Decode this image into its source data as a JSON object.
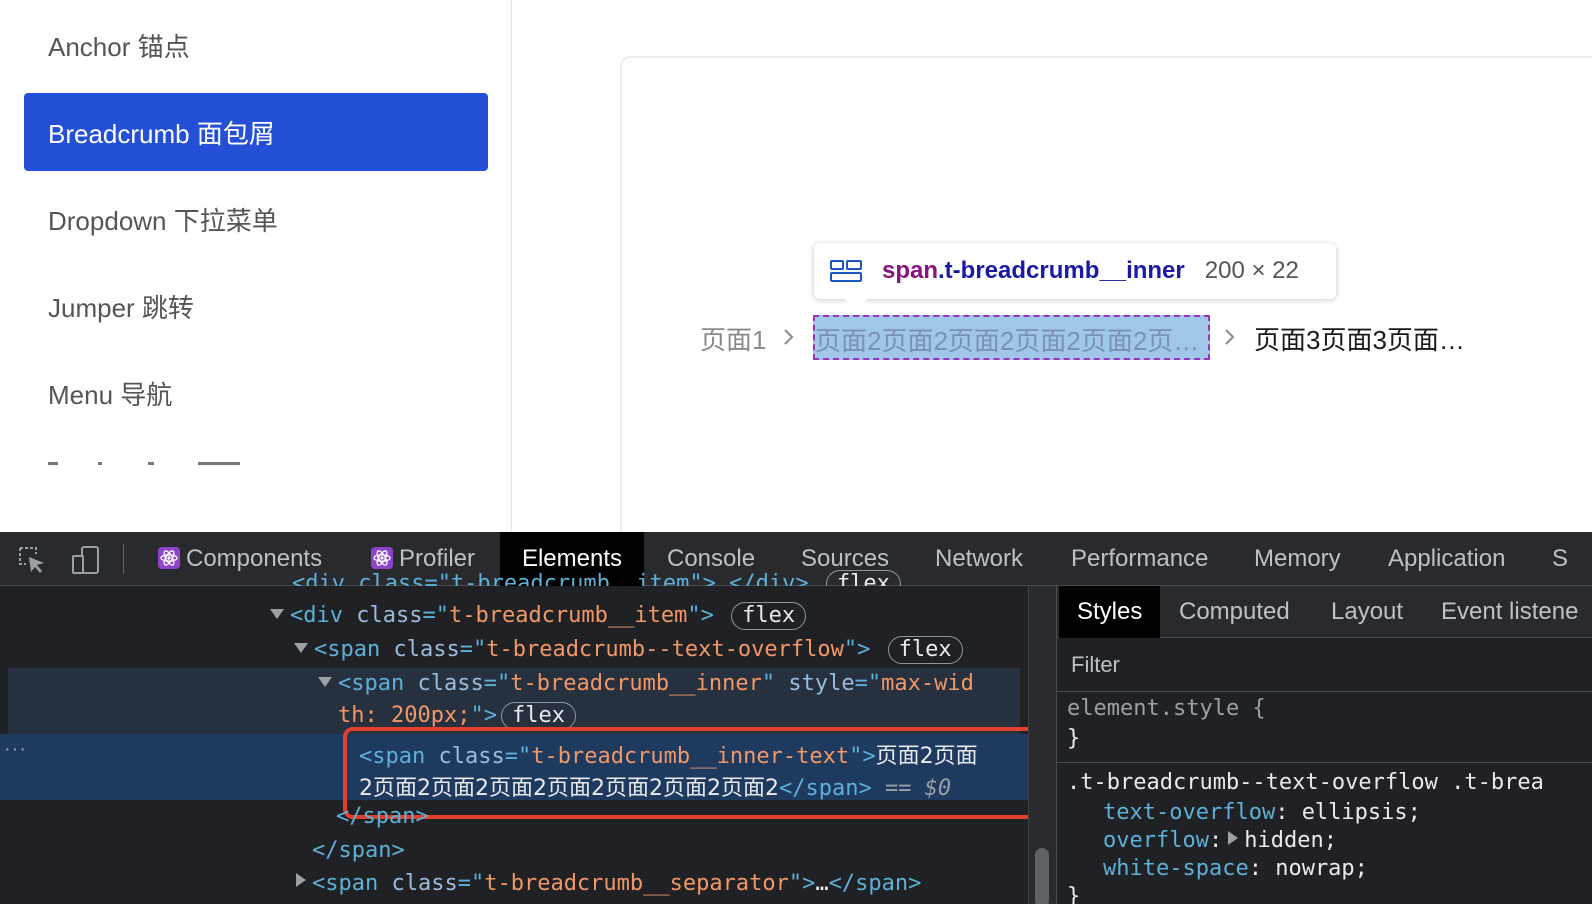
{
  "sidebar": {
    "items": [
      {
        "label": "Anchor 锚点"
      },
      {
        "label": "Breadcrumb 面包屑"
      },
      {
        "label": "Dropdown 下拉菜单"
      },
      {
        "label": "Jumper 跳转"
      },
      {
        "label": "Menu 导航"
      }
    ],
    "active_index": 1,
    "active_color": "#2350d6"
  },
  "demo": {
    "breadcrumb": [
      {
        "label": "页面1"
      },
      {
        "label": "页面2页面2页面2页面2页面2页面2页面2页面2页面2"
      },
      {
        "label": "页面3页面3页面…"
      }
    ],
    "separator_icon": "chevron-right-icon"
  },
  "inspect_tooltip": {
    "icon": "flex-layout-icon",
    "tag": "span",
    "class": ".t-breadcrumb__inner",
    "size": "200 × 22"
  },
  "devtools": {
    "tool_icons": [
      "inspect-element-icon",
      "device-toggle-icon"
    ],
    "tabs": [
      {
        "label": "Components",
        "icon": "react-icon"
      },
      {
        "label": "Profiler",
        "icon": "react-icon"
      },
      {
        "label": "Elements"
      },
      {
        "label": "Console"
      },
      {
        "label": "Sources"
      },
      {
        "label": "Network"
      },
      {
        "label": "Performance"
      },
      {
        "label": "Memory"
      },
      {
        "label": "Application"
      },
      {
        "label": "S"
      }
    ],
    "active_tab": "Elements",
    "dom": {
      "line0": {
        "open": "<div class=\"t-breadcrumb__item\">",
        "ellipsis": "…",
        "close": "</div>",
        "badge": "flex"
      },
      "line1": {
        "tag_open": "<div ",
        "attr": "class",
        "eq": "=\"",
        "value": "t-breadcrumb__item",
        "end": "\">",
        "badge": "flex"
      },
      "line2": {
        "tag_open": "<span ",
        "attr": "class",
        "eq": "=\"",
        "value": "t-breadcrumb--text-overflow",
        "end": "\">",
        "badge": "flex"
      },
      "line3": {
        "tag_open": "<span ",
        "attr": "class",
        "eq": "=\"",
        "value": "t-breadcrumb__inner",
        "mid": "\" ",
        "attr2": "style",
        "eq2": "=\"",
        "value2a": "max-wid"
      },
      "line4": {
        "value2b": "th: 200px;",
        "end": "\">",
        "badge": "flex"
      },
      "line5": {
        "tag_open": "<span ",
        "attr": "class",
        "eq": "=\"",
        "value": "t-breadcrumb__inner-text",
        "end": "\">",
        "text": "页面2页面"
      },
      "line6": {
        "text": "2页面2页面2页面2页面2页面2页面2页面2",
        "close": "</span>",
        "marker": " == $0"
      },
      "line7": {
        "close": "</span>"
      },
      "line8": {
        "close": "</span>"
      },
      "line9": {
        "tag_open": "<span ",
        "attr": "class",
        "eq": "=\"",
        "value": "t-breadcrumb__separator",
        "end": "\">",
        "ellipsis": "…",
        "close": "</span>"
      },
      "dots": "···"
    },
    "styles": {
      "tabs": [
        {
          "label": "Styles"
        },
        {
          "label": "Computed"
        },
        {
          "label": "Layout"
        },
        {
          "label": "Event listene"
        }
      ],
      "active_tab": "Styles",
      "filter_placeholder": "Filter",
      "element_style_selector": "element.style {",
      "element_style_close": "}",
      "rule_selector": ".t-breadcrumb--text-overflow .t-brea",
      "declarations": [
        {
          "prop": "text-overflow",
          "value": "ellipsis;"
        },
        {
          "prop": "overflow",
          "value": "hidden;"
        },
        {
          "prop": "white-space",
          "value": "nowrap;"
        }
      ],
      "rule_close": "}"
    }
  }
}
